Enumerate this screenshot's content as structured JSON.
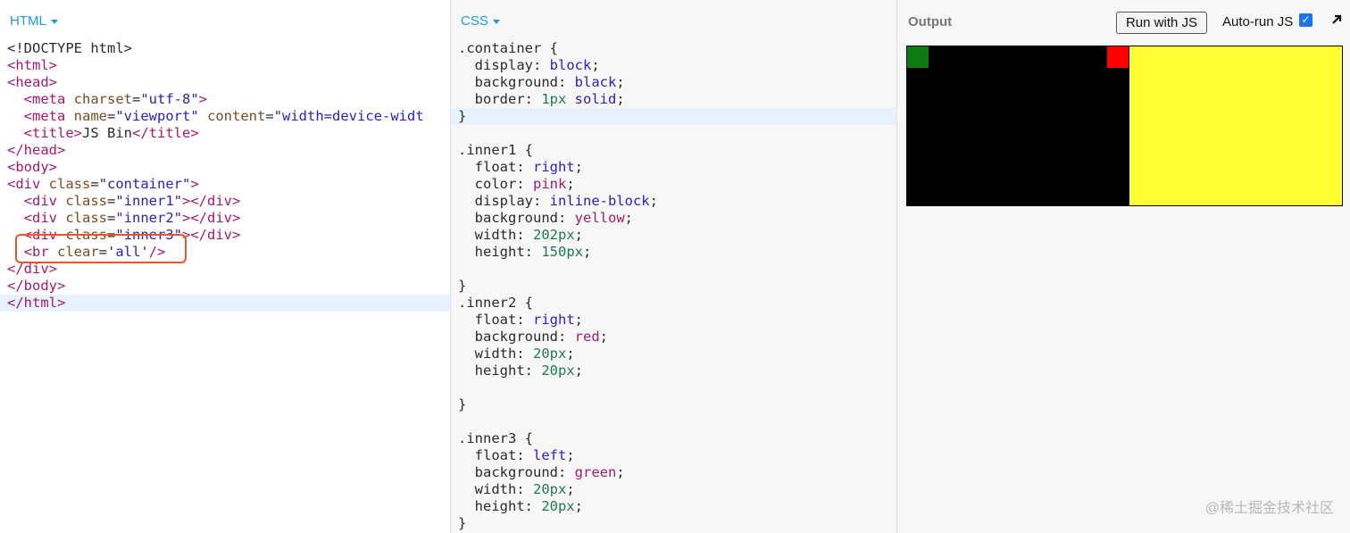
{
  "html_panel": {
    "tab_label": "HTML",
    "lines": [
      [
        {
          "c": "p",
          "t": "<!DOCTYPE html>"
        }
      ],
      [
        {
          "c": "t",
          "t": "<html>"
        }
      ],
      [
        {
          "c": "t",
          "t": "<head>"
        }
      ],
      [
        {
          "c": "p",
          "t": "  "
        },
        {
          "c": "t",
          "t": "<meta "
        },
        {
          "c": "a",
          "t": "charset"
        },
        {
          "c": "p",
          "t": "="
        },
        {
          "c": "s",
          "t": "\"utf-8\""
        },
        {
          "c": "t",
          "t": ">"
        }
      ],
      [
        {
          "c": "p",
          "t": "  "
        },
        {
          "c": "t",
          "t": "<meta "
        },
        {
          "c": "a",
          "t": "name"
        },
        {
          "c": "p",
          "t": "="
        },
        {
          "c": "s",
          "t": "\"viewport\""
        },
        {
          "c": "p",
          "t": " "
        },
        {
          "c": "a",
          "t": "content"
        },
        {
          "c": "p",
          "t": "="
        },
        {
          "c": "s",
          "t": "\"width=device-widt"
        }
      ],
      [
        {
          "c": "p",
          "t": "  "
        },
        {
          "c": "t",
          "t": "<title>"
        },
        {
          "c": "p",
          "t": "JS Bin"
        },
        {
          "c": "t",
          "t": "</title>"
        }
      ],
      [
        {
          "c": "t",
          "t": "</head>"
        }
      ],
      [
        {
          "c": "t",
          "t": "<body>"
        }
      ],
      [
        {
          "c": "t",
          "t": "<div "
        },
        {
          "c": "a",
          "t": "class"
        },
        {
          "c": "p",
          "t": "="
        },
        {
          "c": "s",
          "t": "\"container\""
        },
        {
          "c": "t",
          "t": ">"
        }
      ],
      [
        {
          "c": "p",
          "t": "  "
        },
        {
          "c": "t",
          "t": "<div "
        },
        {
          "c": "a",
          "t": "class"
        },
        {
          "c": "p",
          "t": "="
        },
        {
          "c": "s",
          "t": "\"inner1\""
        },
        {
          "c": "t",
          "t": "></div>"
        }
      ],
      [
        {
          "c": "p",
          "t": "  "
        },
        {
          "c": "t",
          "t": "<div "
        },
        {
          "c": "a",
          "t": "class"
        },
        {
          "c": "p",
          "t": "="
        },
        {
          "c": "s",
          "t": "\"inner2\""
        },
        {
          "c": "t",
          "t": "></div>"
        }
      ],
      [
        {
          "c": "p",
          "t": "  "
        },
        {
          "c": "t",
          "t": "<div "
        },
        {
          "c": "a",
          "t": "class"
        },
        {
          "c": "p",
          "t": "="
        },
        {
          "c": "s",
          "t": "\"inner3\""
        },
        {
          "c": "t",
          "t": "></div>"
        }
      ],
      [
        {
          "c": "p",
          "t": "  "
        },
        {
          "c": "t",
          "t": "<br "
        },
        {
          "c": "a",
          "t": "clear"
        },
        {
          "c": "p",
          "t": "="
        },
        {
          "c": "s",
          "t": "'all'"
        },
        {
          "c": "t",
          "t": "/>"
        }
      ],
      [
        {
          "c": "t",
          "t": "</div>"
        }
      ],
      [
        {
          "c": "t",
          "t": "</body>"
        }
      ],
      [
        {
          "c": "t",
          "t": "</html>"
        }
      ]
    ],
    "active_line": 15
  },
  "css_panel": {
    "tab_label": "CSS",
    "lines": [
      [
        {
          "c": "p",
          "t": ".container {"
        }
      ],
      [
        {
          "c": "p",
          "t": "  display: "
        },
        {
          "c": "v",
          "t": "block"
        },
        {
          "c": "p",
          "t": ";"
        }
      ],
      [
        {
          "c": "p",
          "t": "  background: "
        },
        {
          "c": "v",
          "t": "black"
        },
        {
          "c": "p",
          "t": ";"
        }
      ],
      [
        {
          "c": "p",
          "t": "  border: "
        },
        {
          "c": "n",
          "t": "1px"
        },
        {
          "c": "p",
          "t": " "
        },
        {
          "c": "v",
          "t": "solid"
        },
        {
          "c": "p",
          "t": ";"
        }
      ],
      [
        {
          "c": "p",
          "t": "}"
        }
      ],
      [],
      [
        {
          "c": "p",
          "t": ".inner1 {"
        }
      ],
      [
        {
          "c": "p",
          "t": "  float: "
        },
        {
          "c": "v",
          "t": "right"
        },
        {
          "c": "p",
          "t": ";"
        }
      ],
      [
        {
          "c": "p",
          "t": "  color: "
        },
        {
          "c": "t",
          "t": "pink"
        },
        {
          "c": "p",
          "t": ";"
        }
      ],
      [
        {
          "c": "p",
          "t": "  display: "
        },
        {
          "c": "v",
          "t": "inline-block"
        },
        {
          "c": "p",
          "t": ";"
        }
      ],
      [
        {
          "c": "p",
          "t": "  background: "
        },
        {
          "c": "t",
          "t": "yellow"
        },
        {
          "c": "p",
          "t": ";"
        }
      ],
      [
        {
          "c": "p",
          "t": "  width: "
        },
        {
          "c": "n",
          "t": "202px"
        },
        {
          "c": "p",
          "t": ";"
        }
      ],
      [
        {
          "c": "p",
          "t": "  height: "
        },
        {
          "c": "n",
          "t": "150px"
        },
        {
          "c": "p",
          "t": ";"
        }
      ],
      [],
      [
        {
          "c": "p",
          "t": "}"
        }
      ],
      [
        {
          "c": "p",
          "t": ".inner2 {"
        }
      ],
      [
        {
          "c": "p",
          "t": "  float: "
        },
        {
          "c": "v",
          "t": "right"
        },
        {
          "c": "p",
          "t": ";"
        }
      ],
      [
        {
          "c": "p",
          "t": "  background: "
        },
        {
          "c": "t",
          "t": "red"
        },
        {
          "c": "p",
          "t": ";"
        }
      ],
      [
        {
          "c": "p",
          "t": "  width: "
        },
        {
          "c": "n",
          "t": "20px"
        },
        {
          "c": "p",
          "t": ";"
        }
      ],
      [
        {
          "c": "p",
          "t": "  height: "
        },
        {
          "c": "n",
          "t": "20px"
        },
        {
          "c": "p",
          "t": ";"
        }
      ],
      [],
      [
        {
          "c": "p",
          "t": "}"
        }
      ],
      [],
      [
        {
          "c": "p",
          "t": ".inner3 {"
        }
      ],
      [
        {
          "c": "p",
          "t": "  float: "
        },
        {
          "c": "v",
          "t": "left"
        },
        {
          "c": "p",
          "t": ";"
        }
      ],
      [
        {
          "c": "p",
          "t": "  background: "
        },
        {
          "c": "t",
          "t": "green"
        },
        {
          "c": "p",
          "t": ";"
        }
      ],
      [
        {
          "c": "p",
          "t": "  width: "
        },
        {
          "c": "n",
          "t": "20px"
        },
        {
          "c": "p",
          "t": ";"
        }
      ],
      [
        {
          "c": "p",
          "t": "  height: "
        },
        {
          "c": "n",
          "t": "20px"
        },
        {
          "c": "p",
          "t": ";"
        }
      ],
      [
        {
          "c": "p",
          "t": "}"
        }
      ]
    ],
    "active_line": 4
  },
  "output_panel": {
    "title": "Output",
    "run_button_label": "Run with JS",
    "auto_run_label": "Auto-run JS",
    "auto_run_checked": true,
    "render_colors": {
      "container": "#000000",
      "inner1": "#ffff33",
      "inner2": "#ff0000",
      "inner3": "#0f7a12"
    }
  },
  "annotation": {
    "highlight_color": "#f0532c"
  },
  "watermark": "@稀土掘金技术社区"
}
